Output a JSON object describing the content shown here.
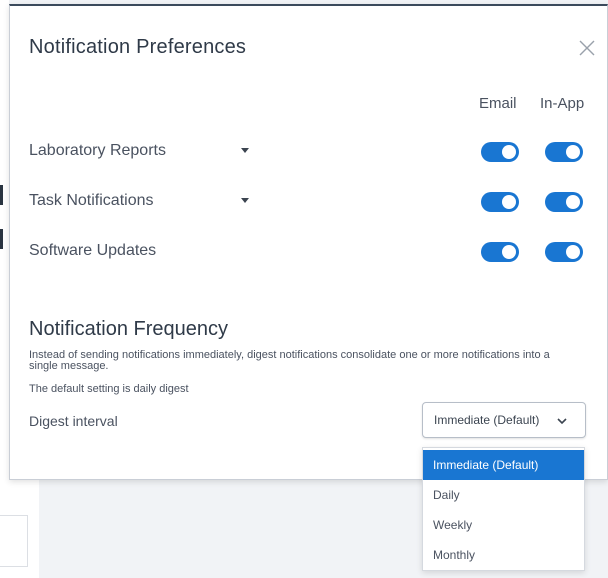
{
  "modal": {
    "title": "Notification Preferences",
    "close_icon": "close-icon"
  },
  "columns": {
    "email": "Email",
    "in_app": "In-App"
  },
  "preferences": [
    {
      "label": "Laboratory Reports",
      "has_caret": true,
      "email": true,
      "in_app": true
    },
    {
      "label": "Task Notifications",
      "has_caret": true,
      "email": true,
      "in_app": true
    },
    {
      "label": "Software Updates",
      "has_caret": false,
      "email": true,
      "in_app": true
    }
  ],
  "frequency": {
    "title": "Notification Frequency",
    "description": "Instead of sending notifications immediately, digest notifications consolidate one or more notifications into a single message.",
    "default_note": "The default setting is daily digest",
    "digest_label": "Digest interval",
    "selected_value": "Immediate (Default)",
    "options": [
      "Immediate (Default)",
      "Daily",
      "Weekly",
      "Monthly"
    ]
  },
  "colors": {
    "accent": "#1976d2",
    "text": "#4a5260",
    "title": "#2f3a48"
  }
}
